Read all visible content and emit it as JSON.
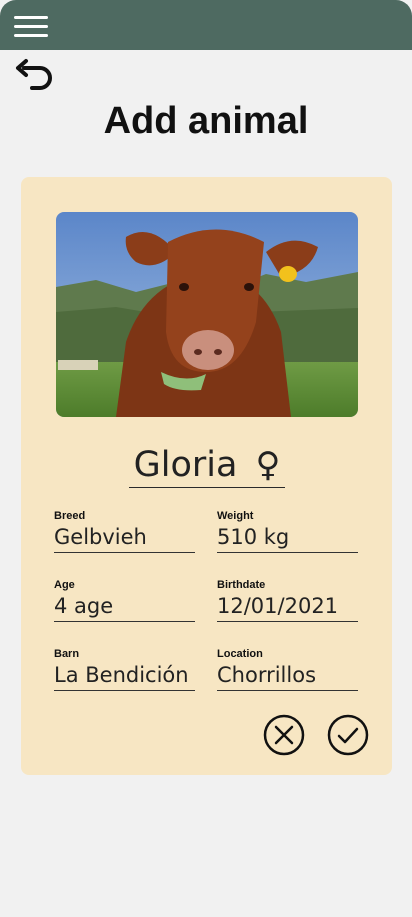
{
  "header": {
    "menu_icon": "hamburger-menu-icon",
    "bar_color": "#4e6a61"
  },
  "nav": {
    "back_icon": "undo-arrow-icon"
  },
  "page": {
    "title": "Add animal"
  },
  "animal": {
    "name": "Gloria",
    "sex_symbol": "♀",
    "photo": "brown-cow-photo",
    "fields": {
      "breed": {
        "label": "Breed",
        "value": "Gelbvieh"
      },
      "weight": {
        "label": "Weight",
        "value": "510 kg"
      },
      "age": {
        "label": "Age",
        "value": "4 age"
      },
      "birthdate": {
        "label": "Birthdate",
        "value": "12/01/2021"
      },
      "barn": {
        "label": "Barn",
        "value": "La Bendición"
      },
      "location": {
        "label": "Location",
        "value": "Chorrillos"
      }
    }
  },
  "actions": {
    "cancel_icon": "circle-x-icon",
    "confirm_icon": "circle-check-icon"
  },
  "colors": {
    "card_bg": "#f7e6c3",
    "page_bg": "#f1f1f1"
  }
}
